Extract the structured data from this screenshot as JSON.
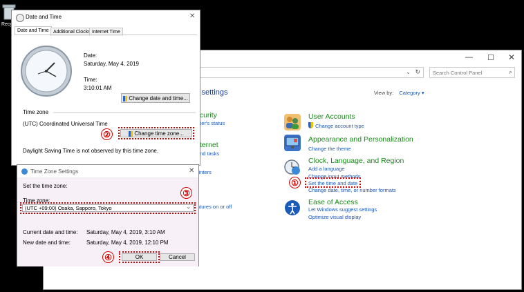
{
  "desktop": {
    "recycle_label": "Recy"
  },
  "control_panel": {
    "search_placeholder": "Search Control Panel",
    "heading_fragment": "s settings",
    "view_by_label": "View by:",
    "view_by_value": "Category",
    "left_fragments": [
      "ecurity",
      "uter's status",
      "nternet",
      "and tasks",
      "rinters",
      "atures on or off"
    ],
    "categories": [
      {
        "title": "User Accounts",
        "links": [
          "Change account type"
        ]
      },
      {
        "title": "Appearance and Personalization",
        "links": [
          "Change the theme"
        ]
      },
      {
        "title": "Clock, Language, and Region",
        "links": [
          "Add a language",
          "Change input methods",
          "Set the time and date",
          "Change date, time, or number formats"
        ]
      },
      {
        "title": "Ease of Access",
        "links": [
          "Let Windows suggest settings",
          "Optimize visual display"
        ]
      }
    ]
  },
  "date_time": {
    "window_title": "Date and Time",
    "tabs": [
      "Date and Time",
      "Additional Clocks",
      "Internet Time"
    ],
    "date_label": "Date:",
    "date_value": "Saturday, May 4, 2019",
    "time_label": "Time:",
    "time_value": "3:10:01 AM",
    "change_date_button": "Change date and time...",
    "timezone_label": "Time zone",
    "timezone_value": "(UTC) Coordinated Universal Time",
    "change_tz_button": "Change time zone...",
    "dst_note": "Daylight Saving Time is not observed by this time zone."
  },
  "tz_settings": {
    "window_title": "Time Zone Settings",
    "set_label": "Set the time zone:",
    "tz_label": "Time zone:",
    "tz_value": "(UTC +09:00) Osaka, Sapporo, Tokyo",
    "current_label": "Current date and time:",
    "current_value": "Saturday, May 4, 2019, 3:10 AM",
    "new_label": "New date and time:",
    "new_value": "Saturday, May 4, 2019, 12:10 PM",
    "ok_button": "OK",
    "cancel_button": "Cancel"
  },
  "steps": [
    "①",
    "②",
    "③",
    "④"
  ],
  "colors": {
    "annotation_red": "#d40000",
    "link_blue": "#1a56b8",
    "category_green": "#1a8a1a"
  }
}
